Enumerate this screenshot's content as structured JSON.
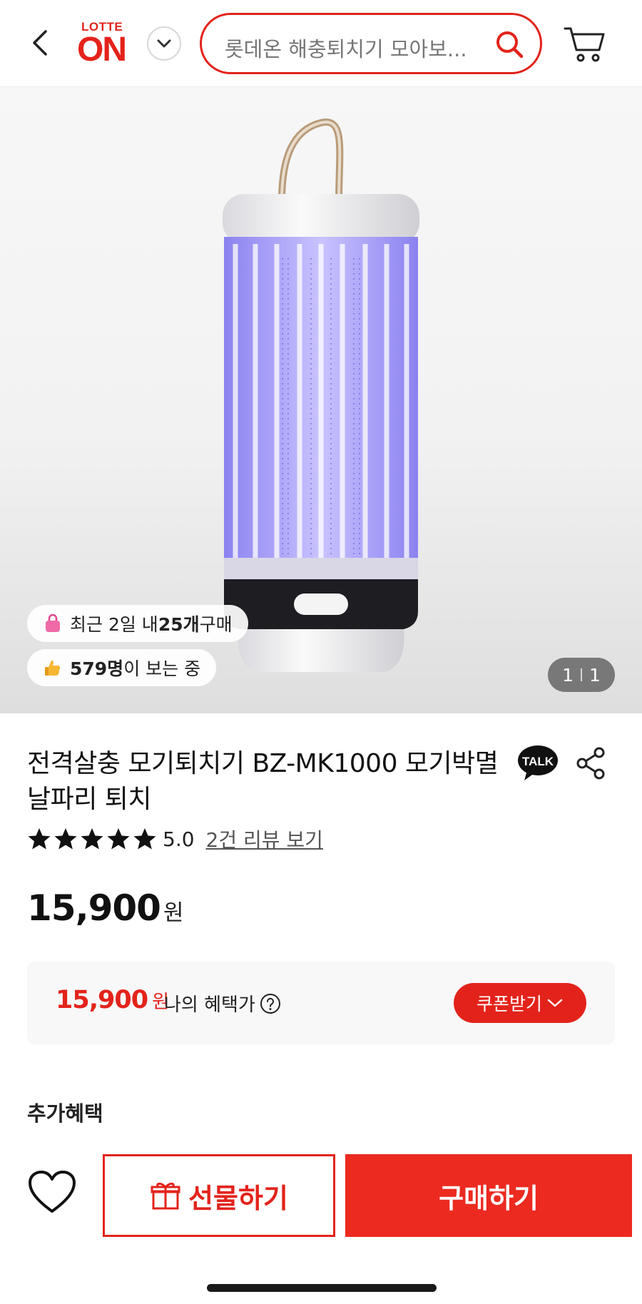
{
  "header": {
    "logo_top": "LOTTE",
    "logo_main": "ON",
    "search_placeholder": "롯데온 해충퇴치기 모아보...",
    "colors": {
      "brand": "#e3231b"
    }
  },
  "hero": {
    "chip_recent": {
      "prefix": "최근 2일 내 ",
      "count": "25개",
      "suffix": " 구매",
      "icon": "shopping-bag-icon"
    },
    "chip_viewers": {
      "count": "579명",
      "suffix": "이 보는 중",
      "icon": "thumbs-up-icon"
    },
    "image_counter": {
      "current": "1",
      "total": "1"
    }
  },
  "product": {
    "title": "전격살충 모기퇴치기 BZ-MK1000 모기박멸 날파리 퇴치",
    "talk_label": "TALK",
    "rating": {
      "stars": 5,
      "score": "5.0",
      "review_link": "2건 리뷰 보기"
    },
    "price": {
      "value": "15,900",
      "unit": "원"
    }
  },
  "benefit": {
    "price": "15,900",
    "unit": "원",
    "label": "나의 혜택가",
    "coupon_button": "쿠폰받기"
  },
  "extra_benefits_title": "추가혜택",
  "bottom_bar": {
    "gift_button": "선물하기",
    "buy_button": "구매하기"
  }
}
